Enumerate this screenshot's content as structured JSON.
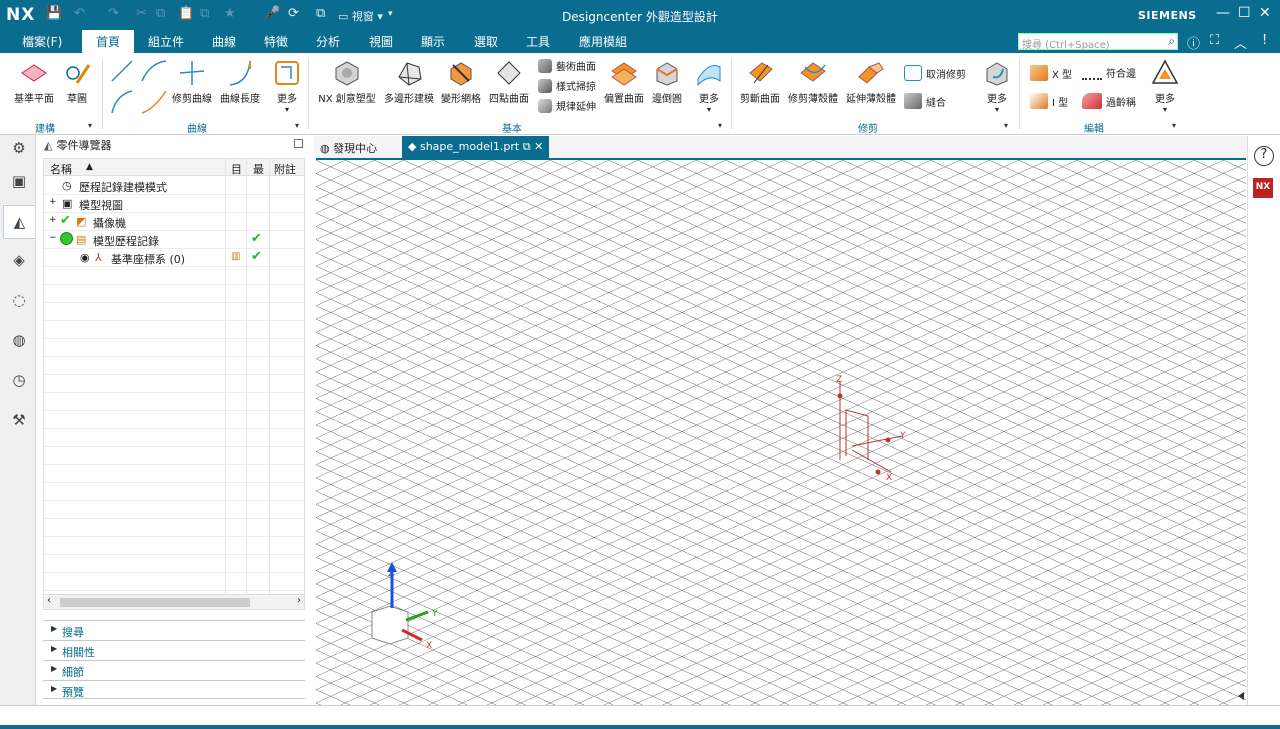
{
  "app": {
    "logo": "NX",
    "title": "Designcenter 外觀造型設計",
    "brand": "SIEMENS",
    "window_menu": "視窗"
  },
  "menu": {
    "items": [
      "檔案(F)",
      "首頁",
      "組立件",
      "曲線",
      "特徵",
      "分析",
      "視圖",
      "顯示",
      "選取",
      "工具",
      "應用模組"
    ],
    "active": "首頁"
  },
  "search": {
    "placeholder": "搜尋 (Ctrl+Space)"
  },
  "ribbon": {
    "groups": {
      "construct": "建構",
      "curve": "曲線",
      "basic": "基本",
      "trim": "修剪",
      "edit": "編輯"
    },
    "construct": {
      "datum_plane": "基準平面",
      "sketch": "草圖"
    },
    "curve": {
      "trim_curve": "修剪曲線",
      "curve_length": "曲線長度",
      "more": "更多"
    },
    "basic": {
      "nx_creative": "NX 創意塑型",
      "poly_modeling": "多邊形建模",
      "deform_grid": "變形網格",
      "four_point": "四點曲面",
      "art_surface": "藝術曲面",
      "styled_sweep": "樣式掃掠",
      "law_extension": "規律延伸",
      "offset_surface": "偏置曲面",
      "fillet": "邊倒圓",
      "more": "更多"
    },
    "trim": {
      "trim_surface": "剪斷曲面",
      "trim_sheet": "修剪薄殼體",
      "extend_sheet": "延伸薄殼體",
      "untrim": "取消修剪",
      "sew": "縫合",
      "more": "更多"
    },
    "edit": {
      "x_type": "X 型",
      "i_type": "I 型",
      "match_edge": "符合邊",
      "overcrown": "過齡稱",
      "more": "更多"
    }
  },
  "navigator": {
    "title": "零件導覽器",
    "columns": {
      "name": "名稱",
      "col2": "目",
      "col3": "最",
      "col4": "附註"
    },
    "rows": [
      {
        "label": "歷程記錄建模模式",
        "check": ""
      },
      {
        "label": "模型視圖",
        "check": ""
      },
      {
        "label": "攝像機",
        "check": ""
      },
      {
        "label": "模型歷程記錄",
        "check": "✔"
      },
      {
        "label": "基準座標系 (0)",
        "check": "✔"
      }
    ],
    "sections": [
      "搜尋",
      "相關性",
      "細節",
      "預覽"
    ]
  },
  "tabs": {
    "discovery": "發現中心",
    "model": "shape_model1.prt"
  },
  "viewport": {
    "csys_labels": {
      "z": "Z",
      "y": "Y",
      "x": "X"
    },
    "theme_color": "#0a6d8f",
    "nx_badge": "NX"
  }
}
